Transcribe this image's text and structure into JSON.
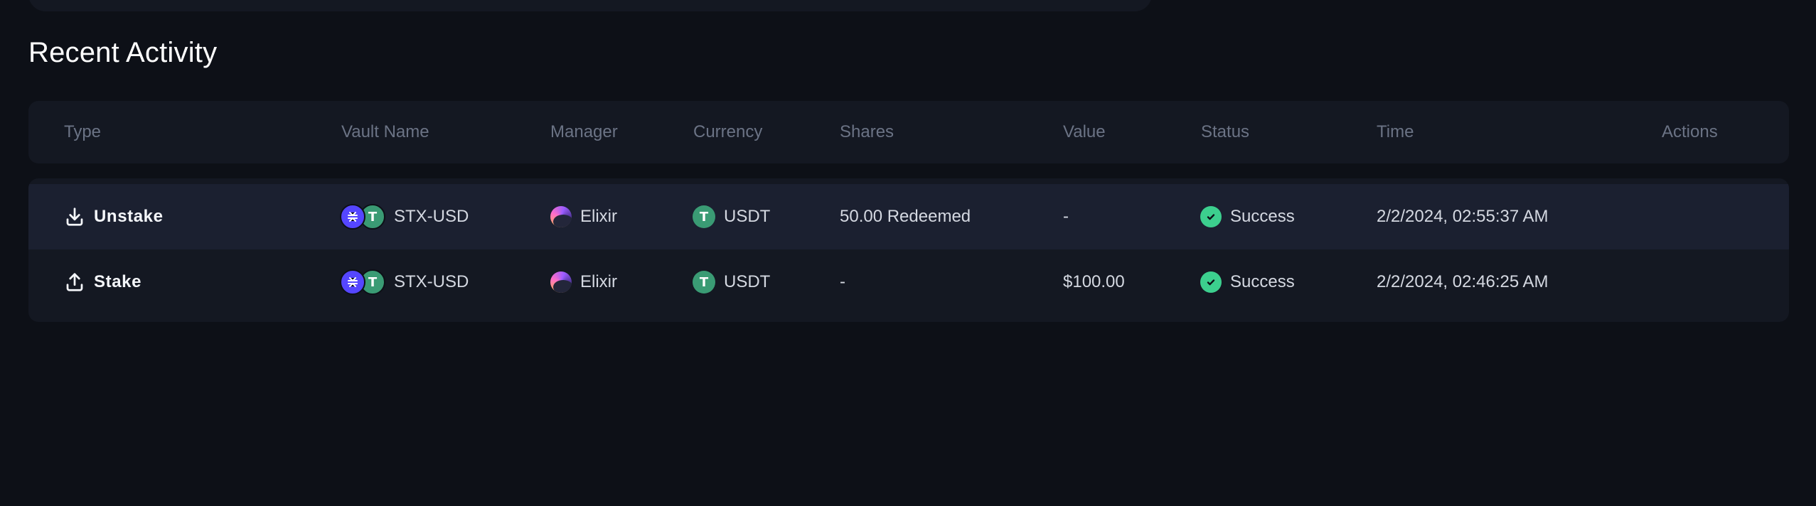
{
  "section_title": "Recent Activity",
  "columns": {
    "type": "Type",
    "vault_name": "Vault Name",
    "manager": "Manager",
    "currency": "Currency",
    "shares": "Shares",
    "value": "Value",
    "status": "Status",
    "time": "Time",
    "actions": "Actions"
  },
  "rows": [
    {
      "type": "Unstake",
      "type_icon": "download-icon",
      "vault_name": "STX-USD",
      "manager": "Elixir",
      "currency": "USDT",
      "shares": "50.00 Redeemed",
      "value": "-",
      "status": "Success",
      "time": "2/2/2024, 02:55:37 AM"
    },
    {
      "type": "Stake",
      "type_icon": "upload-icon",
      "vault_name": "STX-USD",
      "manager": "Elixir",
      "currency": "USDT",
      "shares": "-",
      "value": "$100.00",
      "status": "Success",
      "time": "2/2/2024, 02:46:25 AM"
    }
  ],
  "colors": {
    "background": "#0d1017",
    "card": "#141822",
    "highlight_row": "#1b2030",
    "stx_brand": "#5546ff",
    "usdt_brand": "#3a9b74",
    "success": "#3ccf8e",
    "muted_text": "#6b7385"
  }
}
